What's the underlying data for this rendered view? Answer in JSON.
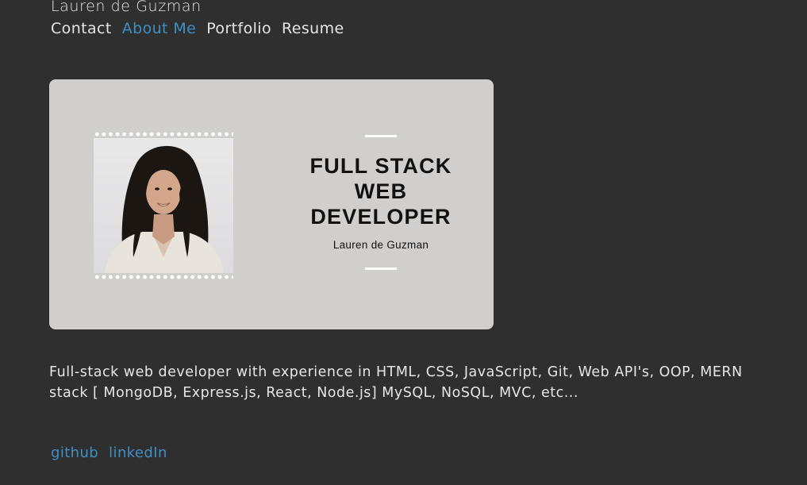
{
  "site": {
    "title": "Lauren de Guzman"
  },
  "nav": {
    "items": [
      {
        "label": "Contact"
      },
      {
        "label": "About Me"
      },
      {
        "label": "Portfolio"
      },
      {
        "label": "Resume"
      }
    ],
    "active": "About Me"
  },
  "card": {
    "headline_line1": "FULL STACK",
    "headline_line2": "WEB",
    "headline_line3": "DEVELOPER",
    "name": "Lauren de Guzman"
  },
  "bio": {
    "text": "Full-stack web developer with experience in HTML, CSS, JavaScript, Git, Web API's, OOP, MERN stack [ MongoDB, Express.js, React, Node.js] MySQL, NoSQL, MVC, etc..."
  },
  "footer": {
    "links": [
      {
        "label": "github"
      },
      {
        "label": "linkedIn"
      }
    ]
  },
  "colors": {
    "background": "#2f2f2f",
    "text": "#e6e6e6",
    "accent": "#3f8fc4",
    "card": "#d0cfcd"
  }
}
